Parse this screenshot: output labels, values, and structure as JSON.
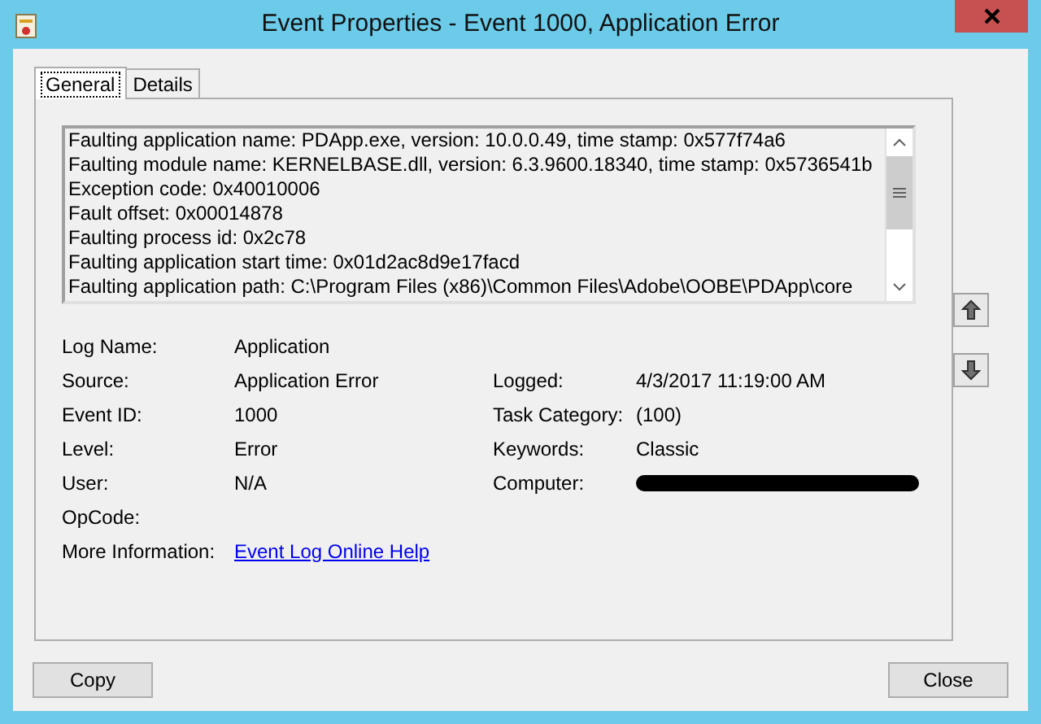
{
  "window": {
    "title": "Event Properties - Event 1000, Application Error"
  },
  "tabs": [
    {
      "label": "General",
      "selected": true
    },
    {
      "label": "Details",
      "selected": false
    }
  ],
  "description": [
    "Faulting application name: PDApp.exe, version: 10.0.0.49, time stamp: 0x577f74a6",
    "Faulting module name: KERNELBASE.dll, version: 6.3.9600.18340, time stamp: 0x5736541b",
    "Exception code: 0x40010006",
    "Fault offset: 0x00014878",
    "Faulting process id: 0x2c78",
    "Faulting application start time: 0x01d2ac8d9e17facd",
    "Faulting application path: C:\\Program Files (x86)\\Common Files\\Adobe\\OOBE\\PDApp\\core"
  ],
  "fields": [
    {
      "label": "Log Name:",
      "value": "Application"
    },
    {
      "label": "Source:",
      "value": "Application Error",
      "label_2": "Logged:",
      "value_2": "4/3/2017 11:19:00 AM"
    },
    {
      "label": "Event ID:",
      "value": "1000",
      "label_2": "Task Category:",
      "value_2": "(100)"
    },
    {
      "label": "Level:",
      "value": "Error",
      "label_2": "Keywords:",
      "value_2": "Classic"
    },
    {
      "label": "User:",
      "value": "N/A",
      "label_2": "Computer:",
      "redacted": true
    },
    {
      "label": "OpCode:"
    },
    {
      "label": "More Information:",
      "link": "Event Log Online Help"
    }
  ],
  "buttons": {
    "copy": "Copy",
    "close": "Close"
  }
}
